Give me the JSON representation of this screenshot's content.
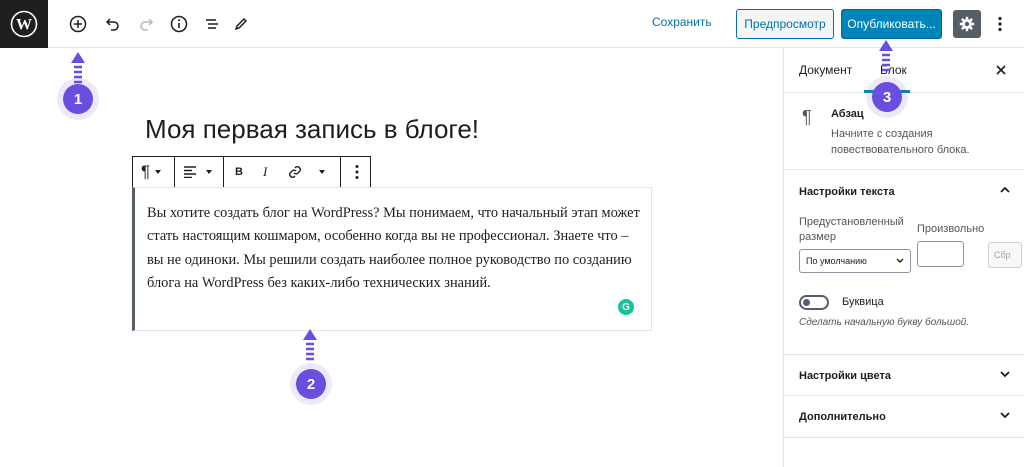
{
  "topbar": {
    "save_label": "Сохранить",
    "preview_label": "Предпросмотр",
    "publish_label": "Опубликовать..."
  },
  "editor": {
    "title": "Моя первая запись в блоге!",
    "paragraph": "Вы хотите создать блог на WordPress? Мы понимаем, что начальный этап может стать настоящим кошмаром, особенно когда вы не профессионал. Знаете что – вы не одиноки. Мы решили создать наиболее полное руководство по созданию блога на WordPress без каких-либо технических знаний.",
    "grammarly_letter": "G"
  },
  "sidebar": {
    "tab_document": "Документ",
    "tab_block": "Блок",
    "block_card": {
      "title": "Абзац",
      "description": "Начните с создания повествовательного блока."
    },
    "text_settings": {
      "title": "Настройки текста",
      "preset_label": "Предустановленный размер",
      "custom_label": "Произвольно",
      "preset_value": "По умолчанию",
      "reset_label": "Сбр",
      "dropcap_label": "Буквица",
      "dropcap_help": "Сделать начальную букву большой."
    },
    "color_settings": {
      "title": "Настройки цвета"
    },
    "advanced": {
      "title": "Дополнительно"
    }
  },
  "annotations": [
    "1",
    "2",
    "3"
  ],
  "colors": {
    "accent": "#0085ba",
    "link": "#0073aa",
    "annotation": "#6a4ee0",
    "grammarly": "#15c39a"
  }
}
